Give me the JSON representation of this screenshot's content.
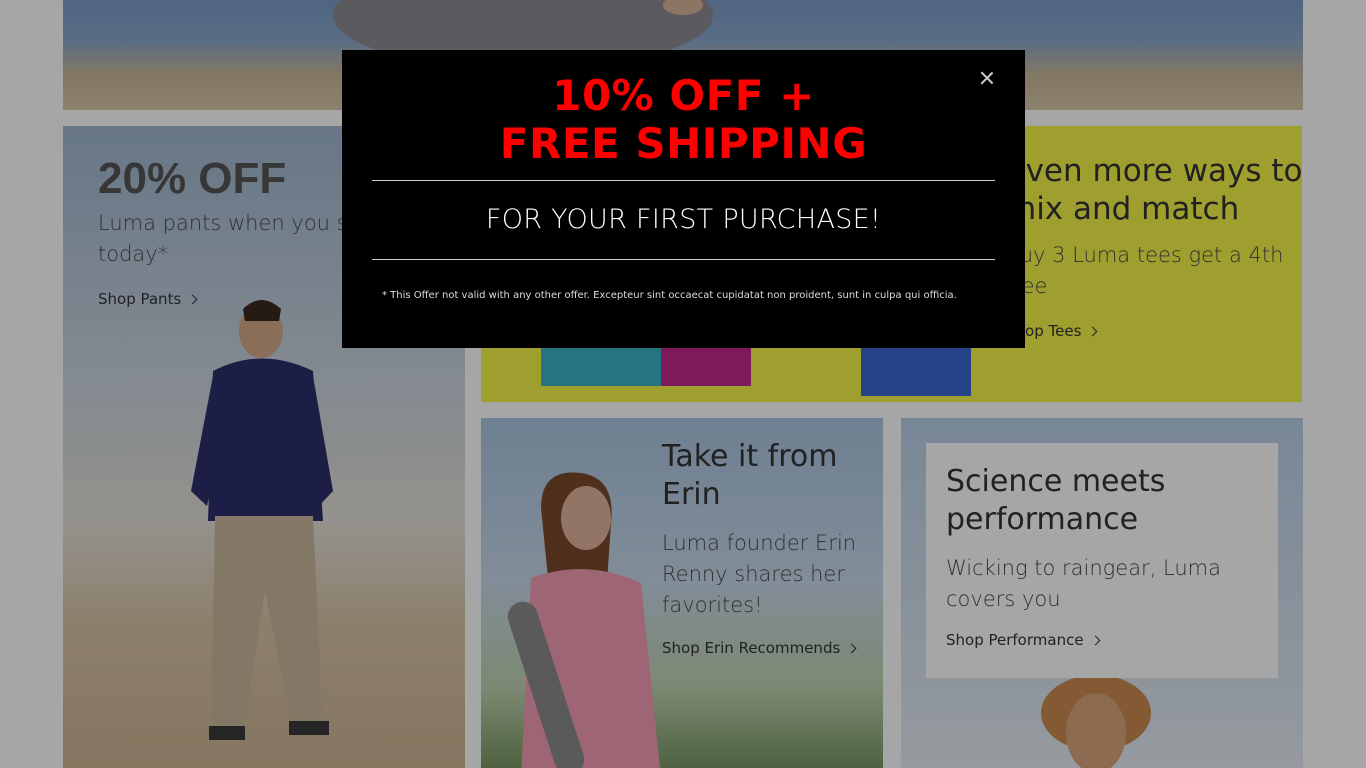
{
  "promo_pants": {
    "title": "20% OFF",
    "lead": "Luma pants when you shop today*",
    "link": "Shop Pants"
  },
  "promo_tees": {
    "heading": "Even more ways to mix and match",
    "lead": "Buy 3 Luma tees get a 4th free",
    "link": "Shop Tees"
  },
  "promo_erin": {
    "heading": "Take it from Erin",
    "lead": "Luma founder Erin Renny shares her favorites!",
    "link": "Shop Erin Recommends"
  },
  "promo_performance": {
    "heading": "Science meets performance",
    "lead": "Wicking to raingear, Luma covers you",
    "link": "Shop Performance"
  },
  "modal": {
    "headline_1": "10% OFF +",
    "headline_2": "FREE SHIPPING",
    "subheading": "FOR YOUR FIRST PURCHASE!",
    "note": "* This Offer not valid with any other offer. Excepteur sint occaecat cupidatat non proident, sunt in culpa qui officia.",
    "accent_color": "#ff0000",
    "close_icon": "close-icon"
  }
}
